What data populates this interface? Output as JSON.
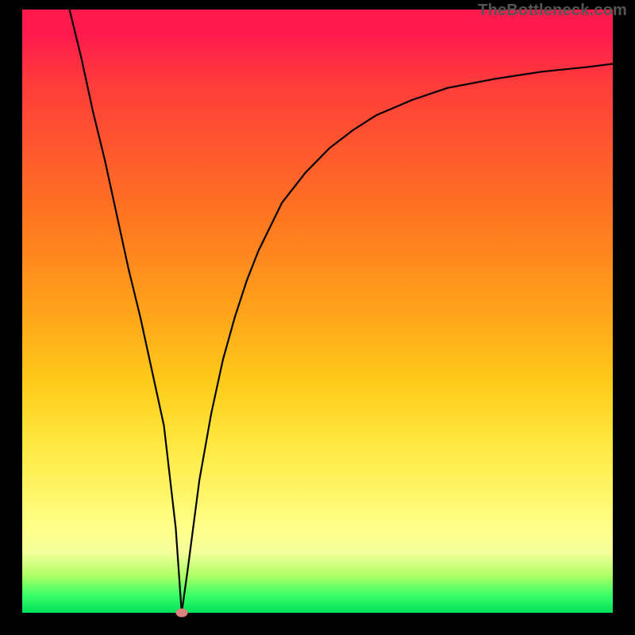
{
  "watermark": "TheBottleneck.com",
  "chart_data": {
    "type": "line",
    "title": "",
    "xlabel": "",
    "ylabel": "",
    "xlim": [
      0,
      100
    ],
    "ylim": [
      0,
      100
    ],
    "grid": false,
    "series": [
      {
        "name": "curve",
        "x": [
          8,
          10,
          12,
          14,
          16,
          18,
          20,
          22,
          24,
          26,
          27,
          28,
          30,
          32,
          34,
          36,
          38,
          40,
          44,
          48,
          52,
          56,
          60,
          66,
          72,
          80,
          88,
          96,
          100
        ],
        "y": [
          100,
          92,
          83,
          75,
          66,
          57,
          49,
          40,
          31,
          14,
          0,
          7,
          22,
          33,
          42,
          49,
          55,
          60,
          68,
          73,
          77,
          80,
          82.5,
          85,
          87,
          88.5,
          89.7,
          90.5,
          91
        ]
      }
    ],
    "marker": {
      "x": 27,
      "y": 0
    },
    "background_gradient": {
      "top": "#ff1a4d",
      "bottom": "#00e05a"
    }
  }
}
